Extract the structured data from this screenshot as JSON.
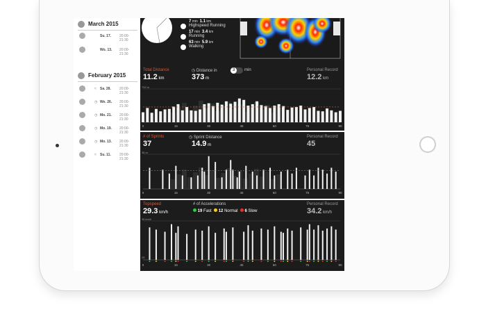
{
  "sidebar": {
    "months": [
      {
        "title": "March 2015",
        "sessions": [
          {
            "date": "Su. 17.",
            "time": "20:00-21:30"
          },
          {
            "date": "Wo. 13.",
            "time": "20:00-21:30"
          }
        ]
      },
      {
        "title": "February 2015",
        "sessions": [
          {
            "date": "Sa. 28.",
            "time": "20:00-21:30",
            "icon": "wifi-icon"
          },
          {
            "date": "We. 26.",
            "time": "20:00-21:30",
            "icon": "clock-icon"
          },
          {
            "date": "Mo. 21.",
            "time": "20:00-21:30",
            "icon": "clock-icon"
          },
          {
            "date": "Mo. 19.",
            "time": "20:00-21:30",
            "icon": "clock-icon"
          },
          {
            "date": "Mo. 13.",
            "time": "20:00-21:30",
            "icon": "clock-icon"
          },
          {
            "date": "Su. 11.",
            "time": "20:00-21:30",
            "icon": "wifi-icon"
          }
        ]
      }
    ]
  },
  "movement": {
    "items": [
      {
        "value": "7",
        "unit": "min",
        "distance": "1.1",
        "dunit": "km",
        "label": "Highspeed Running"
      },
      {
        "value": "17",
        "unit": "min",
        "distance": "3.4",
        "dunit": "km",
        "label": "Running"
      },
      {
        "value": "63",
        "unit": "min",
        "distance": "5.9",
        "dunit": "km",
        "label": "Walking"
      }
    ]
  },
  "distance": {
    "label": "Total Distance",
    "value": "11.2",
    "unit": "km",
    "interval_label": "Distance in",
    "interval_value": "373",
    "interval_unit": "m",
    "toggle_value": "3",
    "toggle_unit": "min",
    "record_label": "Personal Record",
    "record_value": "12.2",
    "record_unit": "km",
    "ymax_label": "700 m"
  },
  "sprints": {
    "label": "# of Sprints",
    "value": "37",
    "distance_label": "Sprint Distance",
    "distance_value": "14.9",
    "distance_unit": "m",
    "record_label": "Personal Record",
    "record_value": "45",
    "ymax_label": "36 m"
  },
  "topspeed": {
    "label": "Topspeed",
    "value": "29.3",
    "unit": "km/h",
    "accel_label": "# of Accelerations",
    "fast": "19",
    "fast_label": "Fast",
    "normal": "12",
    "normal_label": "Normal",
    "slow": "6",
    "slow_label": "Slow",
    "record_label": "Personal Record",
    "record_value": "34.2",
    "record_unit": "km/h",
    "ymax_label": "36 km/h",
    "ymin_label": "25",
    "colors": {
      "fast": "#2ecc40",
      "normal": "#f1d21b",
      "slow": "#e8302a"
    }
  },
  "x_ticks": [
    "0",
    "15",
    "30",
    "45",
    "60",
    "75",
    "90"
  ],
  "chart_data": [
    {
      "type": "bar",
      "title": "Total Distance",
      "ylabel": "700 m",
      "x": [
        0,
        2,
        4,
        6,
        8,
        10,
        12,
        14,
        16,
        18,
        20,
        22,
        24,
        26,
        28,
        30,
        32,
        34,
        36,
        38,
        40,
        42,
        44,
        46,
        48,
        50,
        52,
        54,
        56,
        58,
        60,
        62,
        64,
        66,
        68,
        70,
        72,
        74,
        76,
        78,
        80,
        82,
        84,
        86,
        88,
        90
      ],
      "values": [
        210,
        300,
        200,
        280,
        230,
        270,
        280,
        330,
        380,
        250,
        320,
        250,
        240,
        270,
        380,
        400,
        340,
        410,
        370,
        440,
        390,
        430,
        500,
        470,
        350,
        380,
        440,
        360,
        340,
        300,
        350,
        380,
        340,
        260,
        310,
        320,
        350,
        270,
        300,
        320,
        240,
        230,
        290,
        250,
        210,
        240
      ],
      "ylim": [
        0,
        700
      ]
    },
    {
      "type": "bar",
      "title": "# of Sprints",
      "ylabel": "36 m",
      "x": [
        3,
        9,
        12,
        15,
        18,
        22,
        25,
        27,
        28,
        30,
        33,
        36,
        38,
        40,
        41,
        43,
        44,
        47,
        50,
        52,
        55,
        58,
        60,
        63,
        66,
        68,
        70,
        74,
        76,
        78,
        80,
        82,
        84,
        86,
        88
      ],
      "values": [
        22,
        20,
        16,
        24,
        14,
        12,
        14,
        22,
        18,
        34,
        28,
        12,
        20,
        30,
        20,
        12,
        18,
        24,
        18,
        14,
        20,
        22,
        14,
        18,
        20,
        16,
        22,
        14,
        20,
        14,
        22,
        20,
        16,
        22,
        18
      ],
      "ylim": [
        0,
        36
      ]
    },
    {
      "type": "bar",
      "title": "Topspeed",
      "ylabel": "36 km/h",
      "x": [
        3,
        6,
        10,
        13,
        15,
        16,
        20,
        24,
        27,
        30,
        33,
        37,
        38,
        41,
        46,
        48,
        50,
        54,
        57,
        60,
        63,
        64,
        66,
        68,
        72,
        75,
        76,
        78,
        80,
        82,
        84,
        86,
        88
      ],
      "values": [
        30,
        28,
        26,
        33,
        25,
        31,
        24,
        28,
        27,
        31,
        25,
        29,
        26,
        30,
        26,
        32,
        27,
        29,
        28,
        31,
        26,
        25,
        29,
        27,
        30,
        28,
        33,
        28,
        32,
        27,
        29,
        31,
        28
      ],
      "ylim": [
        0,
        36
      ]
    }
  ]
}
